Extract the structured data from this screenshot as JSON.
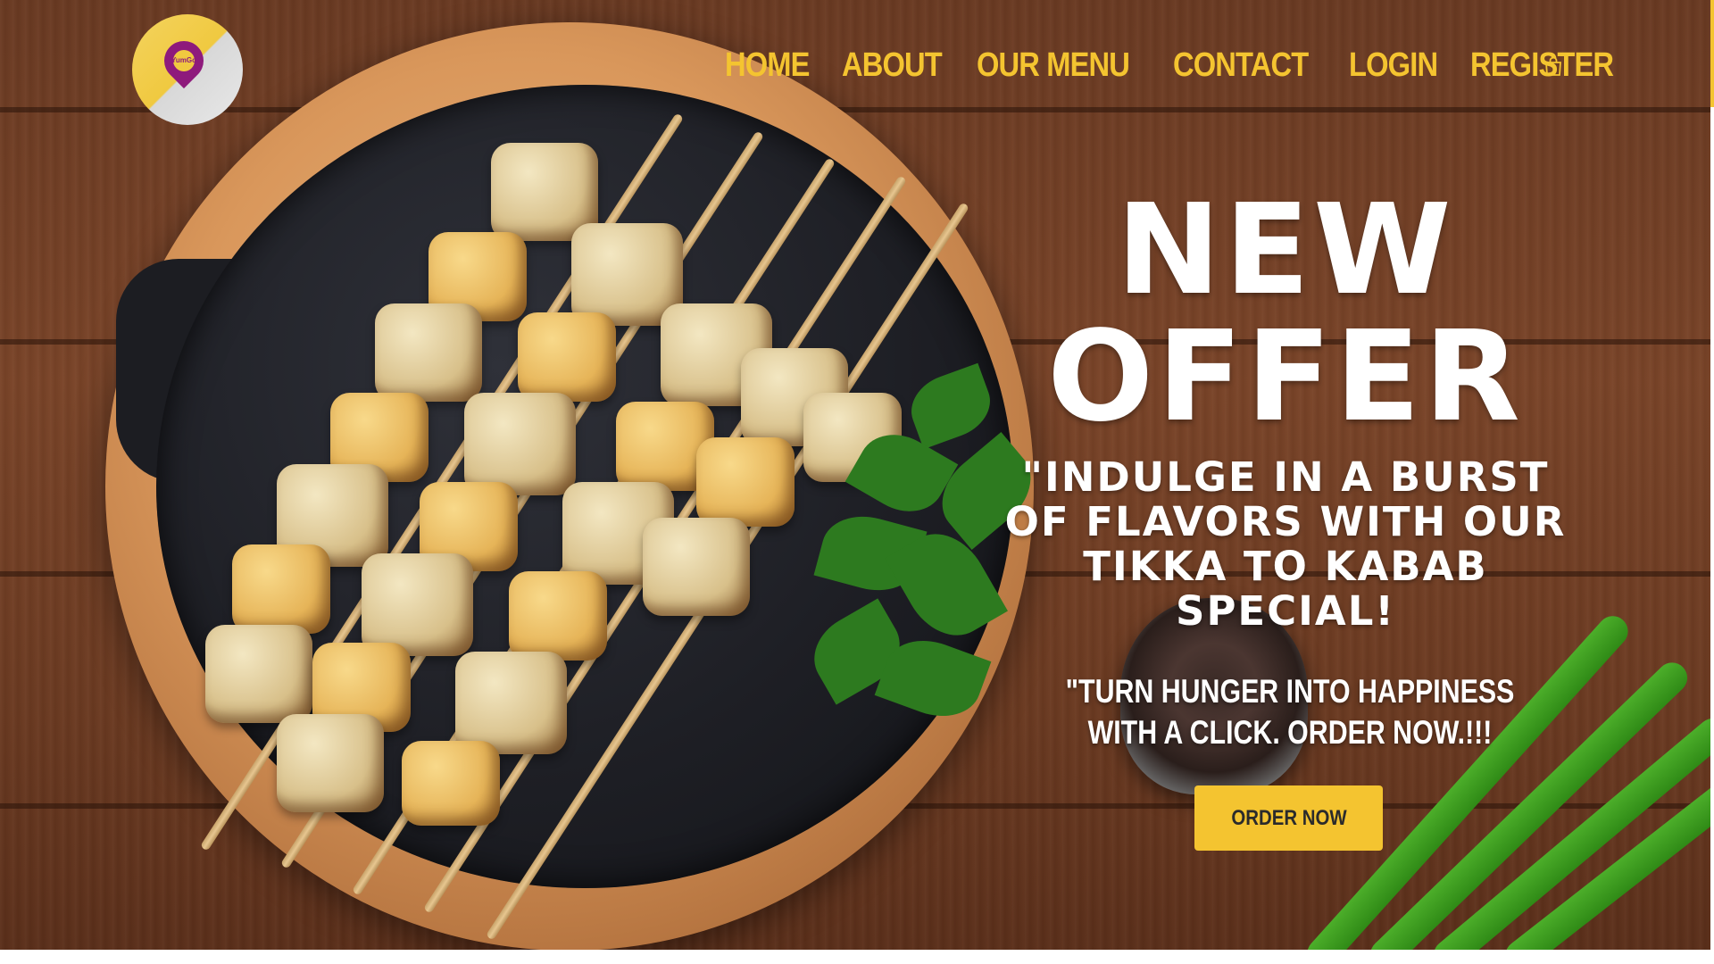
{
  "brand": {
    "logo_text": "YumGo",
    "accent_color": "#f4c430",
    "logo_pin_color": "#8e1a7c"
  },
  "nav": {
    "items": [
      {
        "label": "HOME"
      },
      {
        "label": "ABOUT"
      },
      {
        "label": "OUR MENU"
      },
      {
        "label": "CONTACT"
      },
      {
        "label": "LOGIN"
      },
      {
        "label": "REGISTER"
      }
    ],
    "cart_icon": "shopping-bag-icon"
  },
  "hero": {
    "headline_line1": "NEW",
    "headline_line2": "OFFER",
    "subhead": "\"INDULGE IN A BURST OF FLAVORS WITH OUR TIKKA TO KABAB SPECIAL!",
    "tagline": "\"TURN HUNGER INTO HAPPINESS WITH A CLICK. ORDER NOW.!!!",
    "cta_label": "ORDER NOW"
  }
}
